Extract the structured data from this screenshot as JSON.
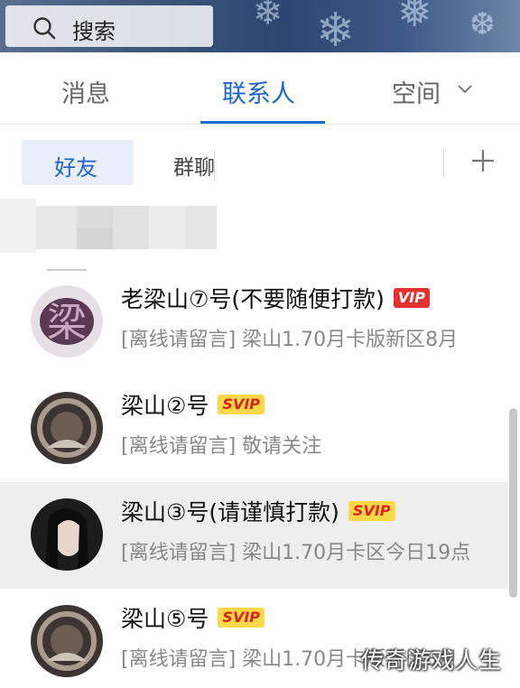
{
  "search": {
    "placeholder": "搜索",
    "icon": "search-icon"
  },
  "tabs": [
    {
      "label": "消息",
      "active": false
    },
    {
      "label": "联系人",
      "active": true
    },
    {
      "label": "空间",
      "active": false
    }
  ],
  "subtabs": {
    "friends": "好友",
    "groups": "群聊",
    "add_icon": "plus-icon"
  },
  "contacts": [
    {
      "name": "老梁山⑦号(不要随便打款)",
      "badge": "VIP",
      "badge_type": "vip",
      "status": "[离线请留言]  梁山1.70月卡版新区8月"
    },
    {
      "name": "梁山②号",
      "badge": "SVIP",
      "badge_type": "svip",
      "status": "[离线请留言]  敬请关注"
    },
    {
      "name": "梁山③号(请谨慎打款)",
      "badge": "SVIP",
      "badge_type": "svip",
      "status": "[离线请留言]  梁山1.70月卡区今日19点",
      "selected": true
    },
    {
      "name": "梁山⑤号",
      "badge": "SVIP",
      "badge_type": "svip",
      "status": "[离线请留言]  梁山1.70月卡版新区8月"
    }
  ],
  "watermark": "传奇游戏人生",
  "colors": {
    "accent": "#1e6bd6",
    "vip": "#e5312f",
    "svip_bg": "#ffd84a",
    "svip_text": "#d8251b"
  }
}
